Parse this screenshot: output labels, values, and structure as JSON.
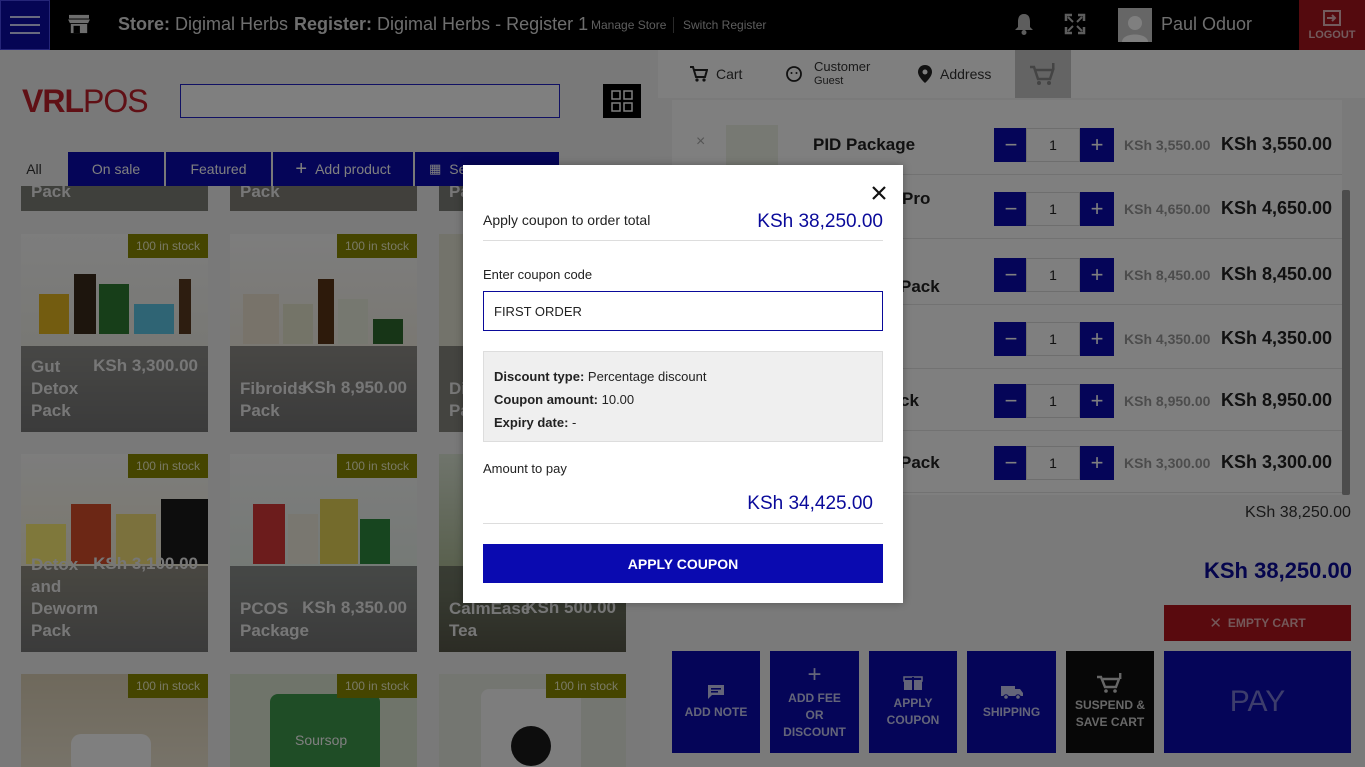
{
  "topbar": {
    "store_key": "Store:",
    "store_value": "Digimal Herbs",
    "register_key": "Register:",
    "register_value": "Digimal Herbs - Register 1",
    "manage_store": "Manage Store",
    "switch_register": "Switch Register",
    "user": "Paul Oduor",
    "logout": "LOGOUT"
  },
  "products": {
    "logo_a": "VRL",
    "logo_b": "POS",
    "search_value": "",
    "tabs": {
      "all": "All",
      "on_sale": "On sale",
      "featured": "Featured",
      "add_product": "Add product",
      "scan": "Se"
    },
    "cards": [
      {
        "name": "Pack",
        "price": "",
        "stock": ""
      },
      {
        "name": "Pack",
        "price": "",
        "stock": ""
      },
      {
        "name": "Pa",
        "price": "",
        "stock": ""
      },
      {
        "name": "Gut Detox Pack",
        "price": "KSh 3,300.00",
        "stock": "100 in stock"
      },
      {
        "name": "Fibroids Pack",
        "price": "KSh 8,950.00",
        "stock": "100 in stock"
      },
      {
        "name": "Di Pa",
        "price": "",
        "stock": ""
      },
      {
        "name": "Detox and Deworm Pack",
        "price": "KSh 3,100.00",
        "stock": "100 in stock"
      },
      {
        "name": "PCOS Package",
        "price": "KSh 8,350.00",
        "stock": "100 in stock"
      },
      {
        "name": "CalmEase Tea",
        "price": "KSh 500.00",
        "stock": ""
      },
      {
        "name": "",
        "price": "",
        "stock": "100 in stock"
      },
      {
        "name": "",
        "price": "",
        "stock": "100 in stock"
      },
      {
        "name": "",
        "price": "",
        "stock": "100 in stock"
      }
    ]
  },
  "cart_panel": {
    "tabs": {
      "cart": "Cart",
      "customer": "Customer",
      "customer_sub": "Guest",
      "address": "Address"
    },
    "items": [
      {
        "name": "PID Package",
        "qty": "1",
        "old_price": "KSh 3,550.00",
        "price": "KSh 3,550.00"
      },
      {
        "name": "Pro",
        "qty": "1",
        "old_price": "KSh 4,650.00",
        "price": "KSh 4,650.00"
      },
      {
        "name": "Pack",
        "qty": "1",
        "old_price": "KSh 8,450.00",
        "price": "KSh 8,450.00"
      },
      {
        "name": "",
        "qty": "1",
        "old_price": "KSh 4,350.00",
        "price": "KSh 4,350.00"
      },
      {
        "name": "ck",
        "qty": "1",
        "old_price": "KSh 8,950.00",
        "price": "KSh 8,950.00"
      },
      {
        "name": "Pack",
        "qty": "1",
        "old_price": "KSh 3,300.00",
        "price": "KSh 3,300.00"
      }
    ],
    "subtotal": "KSh 38,250.00",
    "total": "KSh 38,250.00",
    "empty_cart": "EMPTY CART",
    "actions": {
      "add_note": "ADD NOTE",
      "add_fee": "ADD FEE OR DISCOUNT",
      "apply_coupon": "APPLY COUPON",
      "shipping": "SHIPPING",
      "suspend": "SUSPEND & SAVE CART",
      "pay": "PAY"
    }
  },
  "modal": {
    "title": "Apply coupon to order total",
    "order_total": "KSh 38,250.00",
    "code_label": "Enter coupon code",
    "code_value": "FIRST ORDER",
    "discount_type_label": "Discount type:",
    "discount_type_value": "Percentage discount",
    "coupon_amount_label": "Coupon amount:",
    "coupon_amount_value": "10.00",
    "expiry_label": "Expiry date:",
    "expiry_value": "-",
    "pay_label": "Amount to pay",
    "pay_value": "KSh 34,425.00",
    "apply_button": "APPLY COUPON"
  },
  "colors": {
    "primary": "#0a0ab0",
    "danger": "#b3151c",
    "stock_badge": "#8a8a00"
  }
}
